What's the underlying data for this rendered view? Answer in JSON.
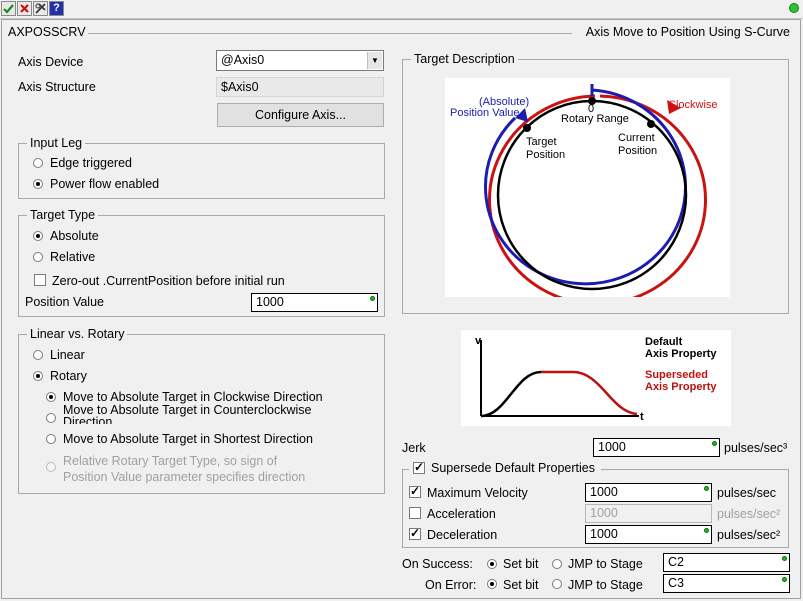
{
  "toolbar": {
    "buttons": [
      "check-icon",
      "cancel-icon",
      "options-icon",
      "help-icon"
    ]
  },
  "header": {
    "instruction": "AXPOSSCRV",
    "description": "Axis Move to Position Using S-Curve"
  },
  "axis": {
    "device_label": "Axis Device",
    "device_value": "@Axis0",
    "structure_label": "Axis Structure",
    "structure_value": "$Axis0",
    "configure_button": "Configure Axis..."
  },
  "input_leg": {
    "title": "Input Leg",
    "options": [
      "Edge triggered",
      "Power flow enabled"
    ],
    "selected": 1
  },
  "target_type": {
    "title": "Target Type",
    "options": [
      "Absolute",
      "Relative"
    ],
    "selected": 0,
    "zero_out_label": "Zero-out .CurrentPosition before initial run",
    "zero_out_checked": false,
    "position_label": "Position Value",
    "position_value": "1000"
  },
  "linear_rotary": {
    "title": "Linear vs. Rotary",
    "options": [
      "Linear",
      "Rotary"
    ],
    "selected": 1,
    "sub_options": [
      "Move to Absolute Target in Clockwise Direction",
      "Move to Absolute Target in Counterclockwise Direction",
      "Move to Absolute Target in Shortest Direction",
      "Relative Rotary Target Type, so sign of",
      "Position Value parameter specifies direction"
    ],
    "sub_selected": 0
  },
  "target_description": {
    "title": "Target Description",
    "absolute_line1": "(Absolute)",
    "absolute_line2": "Position Value",
    "clockwise": "Clockwise",
    "zero": "0",
    "rotary_range": "Rotary Range",
    "target_line1": "Target",
    "target_line2": "Position",
    "current_line1": "Current",
    "current_line2": "Position"
  },
  "profile_legend": {
    "v": "v",
    "t": "t",
    "default_line1": "Default",
    "default_line2": "Axis Property",
    "superseded_line1": "Superseded",
    "superseded_line2": "Axis Property"
  },
  "jerk": {
    "label": "Jerk",
    "value": "1000",
    "unit": "pulses/sec³"
  },
  "supersede": {
    "title": "Supersede Default Properties",
    "checked": true,
    "rows": [
      {
        "label": "Maximum Velocity",
        "checked": true,
        "value": "1000",
        "unit": "pulses/sec",
        "enabled": true
      },
      {
        "label": "Acceleration",
        "checked": false,
        "value": "1000",
        "unit": "pulses/sec²",
        "enabled": false
      },
      {
        "label": "Deceleration",
        "checked": true,
        "value": "1000",
        "unit": "pulses/sec²",
        "enabled": true
      }
    ]
  },
  "on_success": {
    "label": "On Success:",
    "set_bit": "Set bit",
    "jmp": "JMP to Stage",
    "value": "C2",
    "selected": "set_bit"
  },
  "on_error": {
    "label": "On Error:",
    "set_bit": "Set bit",
    "jmp": "JMP to Stage",
    "value": "C3",
    "selected": "set_bit"
  },
  "colors": {
    "clockwise_red": "#cc1111",
    "absolute_blue": "#1c1cae",
    "status_green": "#2fc12f"
  }
}
